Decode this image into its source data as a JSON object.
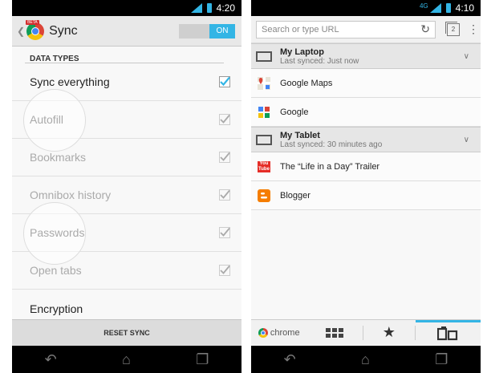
{
  "left": {
    "status": {
      "time": "4:20"
    },
    "action_bar": {
      "title": "Sync",
      "toggle_label": "ON"
    },
    "section_header": "DATA TYPES",
    "items": [
      {
        "label": "Sync everything"
      },
      {
        "label": "Autofill"
      },
      {
        "label": "Bookmarks"
      },
      {
        "label": "Omnibox history"
      },
      {
        "label": "Passwords"
      },
      {
        "label": "Open tabs"
      },
      {
        "label": "Encryption"
      }
    ],
    "reset_button": "RESET SYNC",
    "beta_tag": "BETA"
  },
  "right": {
    "status": {
      "time": "4:10",
      "network": "4G"
    },
    "url_placeholder": "Search or type URL",
    "tab_count": "2",
    "devices": [
      {
        "name": "My Laptop",
        "sync": "Last synced: Just now",
        "tabs": [
          {
            "title": "Google  Maps"
          },
          {
            "title": "Google"
          }
        ]
      },
      {
        "name": "My Tablet",
        "sync": "Last synced: 30 minutes ago",
        "tabs": [
          {
            "title": "The “Life in a Day” Trailer"
          },
          {
            "title": "Blogger"
          }
        ]
      }
    ],
    "bottom_bar": {
      "brand": "chrome"
    },
    "youtube_fav_text": "You Tube"
  },
  "colors": {
    "accent": "#33b5e5",
    "status_bar": "#000000"
  }
}
